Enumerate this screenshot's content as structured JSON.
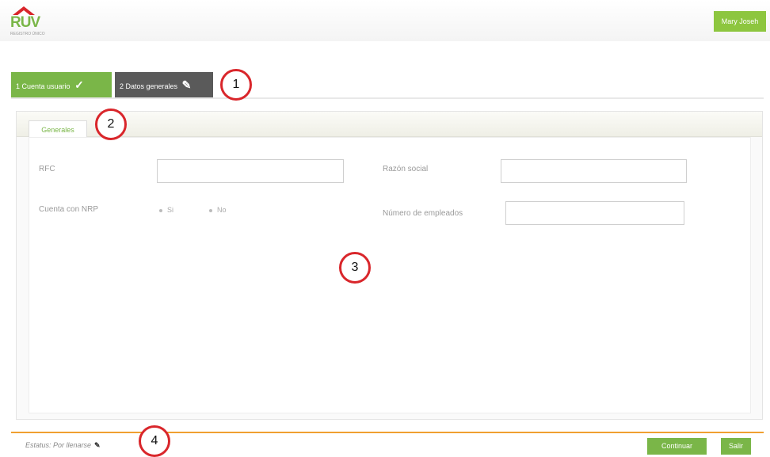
{
  "header": {
    "logo_text": "RUV",
    "logo_sub": "REGISTRO ÚNICO",
    "user_button": "Mary Joseh"
  },
  "steps": [
    {
      "label": "1 Cuenta usuario",
      "glyph": "✓"
    },
    {
      "label": "2 Datos generales",
      "glyph": "✎"
    }
  ],
  "panel": {
    "tab_label": "Generales",
    "fields": {
      "rfc_label": "RFC",
      "rfc_value": "",
      "razon_social_label": "Razón social",
      "razon_social_value": "",
      "cuenta_nrp_label": "Cuenta con NRP",
      "radio_si": "Si",
      "radio_no": "No",
      "num_empleados_label": "Número de empleados",
      "num_empleados_value": ""
    }
  },
  "footer": {
    "status_text": "Estatus: Por llenarse",
    "continue_button": "Continuar",
    "exit_button": "Salir"
  },
  "callouts": [
    "1",
    "2",
    "3",
    "4"
  ],
  "colors": {
    "accent_green": "#7ab648",
    "step_dark": "#5a5a5a",
    "callout_red": "#d9262b",
    "bottom_rule": "#f0a030"
  }
}
